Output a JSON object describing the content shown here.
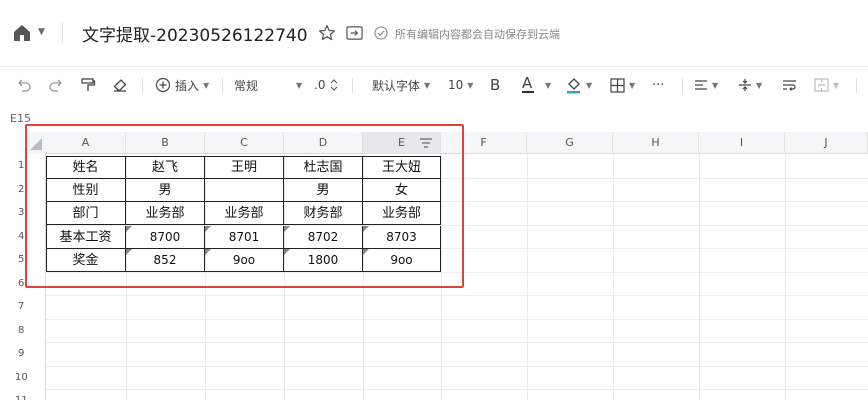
{
  "titlebar": {
    "title": "文字提取-20230526122740",
    "save_status": "所有编辑内容都会自动保存到云端"
  },
  "toolbar": {
    "insert_label": "插入",
    "format_label": "常规",
    "decimal_label": ".0",
    "font_label": "默认字体",
    "font_size": "10",
    "bold_label": "B",
    "font_color_label": "A",
    "more_label": "···"
  },
  "namebox": {
    "value": "E15"
  },
  "grid": {
    "columns": [
      "A",
      "B",
      "C",
      "D",
      "E",
      "F",
      "G",
      "H",
      "I",
      "J"
    ],
    "rows": [
      "1",
      "2",
      "3",
      "4",
      "5",
      "6",
      "7",
      "8",
      "9",
      "10",
      "11"
    ],
    "cells": [
      [
        "姓名",
        "赵飞",
        "王明",
        "杜志国",
        "王大妞"
      ],
      [
        "性别",
        "男",
        "",
        "男",
        "女"
      ],
      [
        "部门",
        "业务部",
        "业务部",
        "财务部",
        "业务部"
      ],
      [
        "基本工资",
        "8700",
        "8701",
        "8702",
        "8703"
      ],
      [
        "奖金",
        "852",
        "9oo",
        "1800",
        "9oo"
      ]
    ]
  },
  "colors": {
    "highlight_box": "#e0433e",
    "header_bg": "#f5f6f7",
    "selected_header": "#e6e8eb"
  }
}
